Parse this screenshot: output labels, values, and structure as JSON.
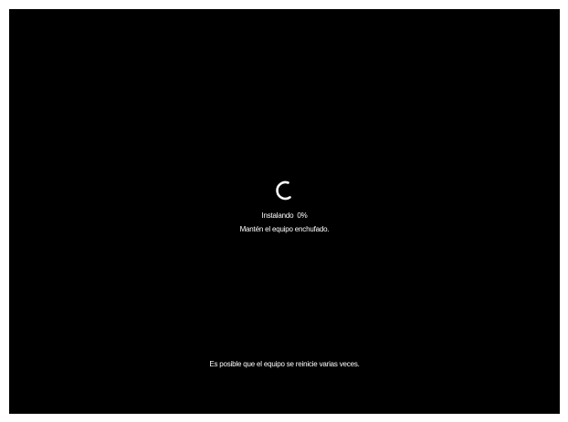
{
  "screen": {
    "background": "#000000",
    "text_color": "#ffffff"
  },
  "spinner": {
    "icon": "spinner-icon"
  },
  "status": {
    "label": "Instalando",
    "percent": "0%"
  },
  "message": {
    "keep_plugged": "Mantén el equipo enchufado."
  },
  "footer": {
    "restart_notice": "Es posible que el equipo se reinicie varias veces."
  }
}
